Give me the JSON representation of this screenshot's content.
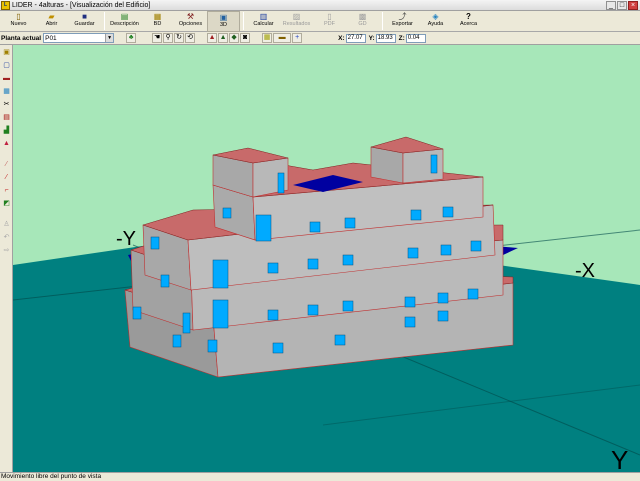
{
  "window": {
    "title": "LIDER - 4alturas - [Visualización del Edificio]",
    "app_icon_text": "L"
  },
  "toolbar": {
    "items": [
      {
        "label": "Nuevo",
        "icon": "new-file-icon",
        "glyph": "🗋"
      },
      {
        "label": "Abrir",
        "icon": "open-folder-icon",
        "glyph": "📂"
      },
      {
        "label": "Guardar",
        "icon": "save-disk-icon",
        "glyph": "💾"
      },
      {
        "label": "Descripción",
        "icon": "description-icon",
        "glyph": "▤"
      },
      {
        "label": "BD",
        "icon": "database-icon",
        "glyph": "▦"
      },
      {
        "label": "Opciones",
        "icon": "options-hammer-icon",
        "glyph": "⚒"
      },
      {
        "label": "3D",
        "icon": "view-3d-icon",
        "glyph": "▣"
      },
      {
        "label": "Calcular",
        "icon": "calculate-icon",
        "glyph": "▥"
      },
      {
        "label": "Resultados",
        "icon": "results-icon",
        "glyph": "▨"
      },
      {
        "label": "PDF",
        "icon": "pdf-icon",
        "glyph": "▯"
      },
      {
        "label": "GD",
        "icon": "gd-icon",
        "glyph": "▩"
      },
      {
        "label": "Exportar",
        "icon": "export-icon",
        "glyph": "⤴"
      },
      {
        "label": "Ayuda",
        "icon": "help-book-icon",
        "glyph": "❓"
      },
      {
        "label": "Acerca",
        "icon": "about-icon",
        "glyph": "?"
      }
    ]
  },
  "toolbar2": {
    "planta_label": "Planta actual",
    "planta_value": "P01",
    "coords": [
      {
        "label": "X:",
        "value": "27.07"
      },
      {
        "label": "Y:",
        "value": "18.93"
      },
      {
        "label": "Z:",
        "value": "0.04"
      }
    ]
  },
  "viewport": {
    "axis_labels": {
      "neg_y": "-Y",
      "neg_x": "-X",
      "pos_y": "Y"
    },
    "colors": {
      "background": "#a7e7b9",
      "ground": "#008080",
      "wall": "#b0b0b0",
      "roof": "#c06060",
      "window": "#00aaff",
      "slab": "#0000a0"
    }
  },
  "status": {
    "text": "Movimiento libre del punto de vista"
  }
}
